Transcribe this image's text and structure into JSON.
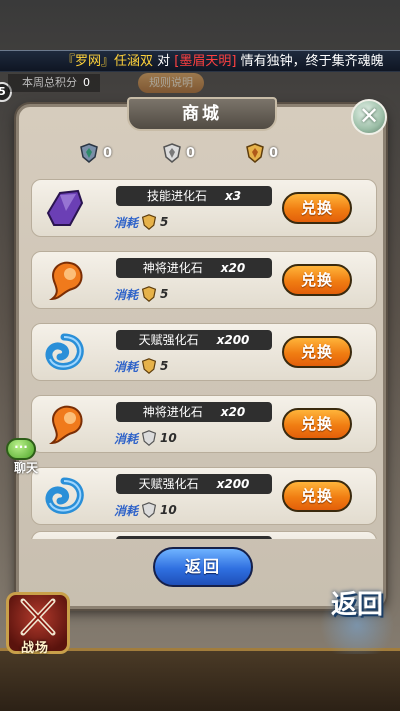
{
  "marquee": {
    "part1": "『罗网』",
    "part2": "任涵双",
    "part3": " 对 ",
    "part4": "[墨眉天明]",
    "part5": " 情有独钟，终于集齐魂魄"
  },
  "week_score": {
    "label": "本周总积分",
    "value": "0"
  },
  "rule_button": "规则说明",
  "left_badge": "5",
  "shop": {
    "title": "商城",
    "close_glyph": "✕",
    "currencies": [
      {
        "icon": "silver-badge-icon",
        "value": "0"
      },
      {
        "icon": "white-badge-icon",
        "value": "0"
      },
      {
        "icon": "gold-badge-icon",
        "value": "0"
      }
    ],
    "cost_label": "消耗",
    "exchange_label": "兑换",
    "items": [
      {
        "name": "技能进化石",
        "qty": "x3",
        "icon": "purple-crystal-icon",
        "cost_icon": "gold-badge-icon",
        "cost": "5"
      },
      {
        "name": "神将进化石",
        "qty": "x20",
        "icon": "orange-magatama-icon",
        "cost_icon": "gold-badge-icon",
        "cost": "5"
      },
      {
        "name": "天赋强化石",
        "qty": "x200",
        "icon": "blue-swirl-icon",
        "cost_icon": "gold-badge-icon",
        "cost": "5"
      },
      {
        "name": "神将进化石",
        "qty": "x20",
        "icon": "orange-magatama-icon",
        "cost_icon": "white-badge-icon",
        "cost": "10"
      },
      {
        "name": "天赋强化石",
        "qty": "x200",
        "icon": "blue-swirl-icon",
        "cost_icon": "white-badge-icon",
        "cost": "10"
      }
    ],
    "back_label": "返回"
  },
  "chat": {
    "label": "聊天",
    "bubble": "···"
  },
  "battle_label": "战场",
  "return_big": "返回",
  "colors": {
    "exchange_button": "#f07d12",
    "back_button": "#2f6fe0",
    "cost_label": "#2f63c9"
  }
}
